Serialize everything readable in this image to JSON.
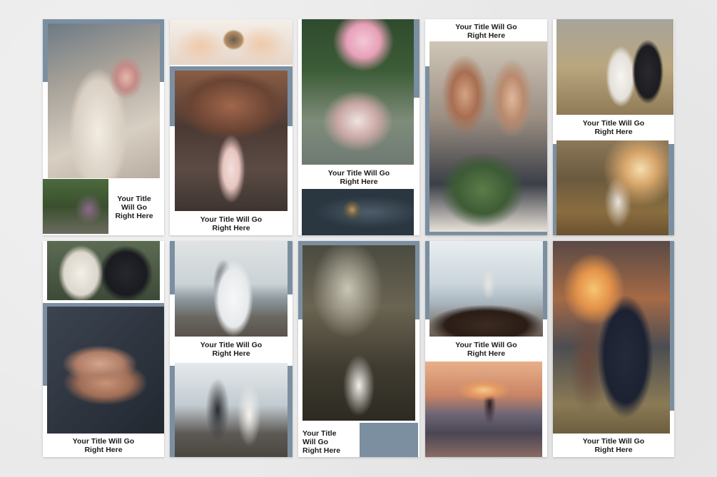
{
  "captions": {
    "card1": "Your Title\nWill Go\nRight Here",
    "card2": "Your Title Will Go\nRight Here",
    "card3": "Your Title Will Go\nRight Here",
    "card4": "Your Title Will Go\nRight Here",
    "card5": "Your Title Will Go\nRight Here",
    "card6": "Your Title Will Go\nRight Here",
    "card7": "Your Title Will Go\nRight Here",
    "card8": "Your Title\nWill Go\nRight Here",
    "card9": "Your Title Will Go\nRight Here",
    "card10": "Your Title Will Go\nRight Here"
  },
  "colors": {
    "accent": "#7b8fa1",
    "background": "#e9e9e9",
    "card": "#ffffff",
    "text": "#1c1c1c"
  }
}
